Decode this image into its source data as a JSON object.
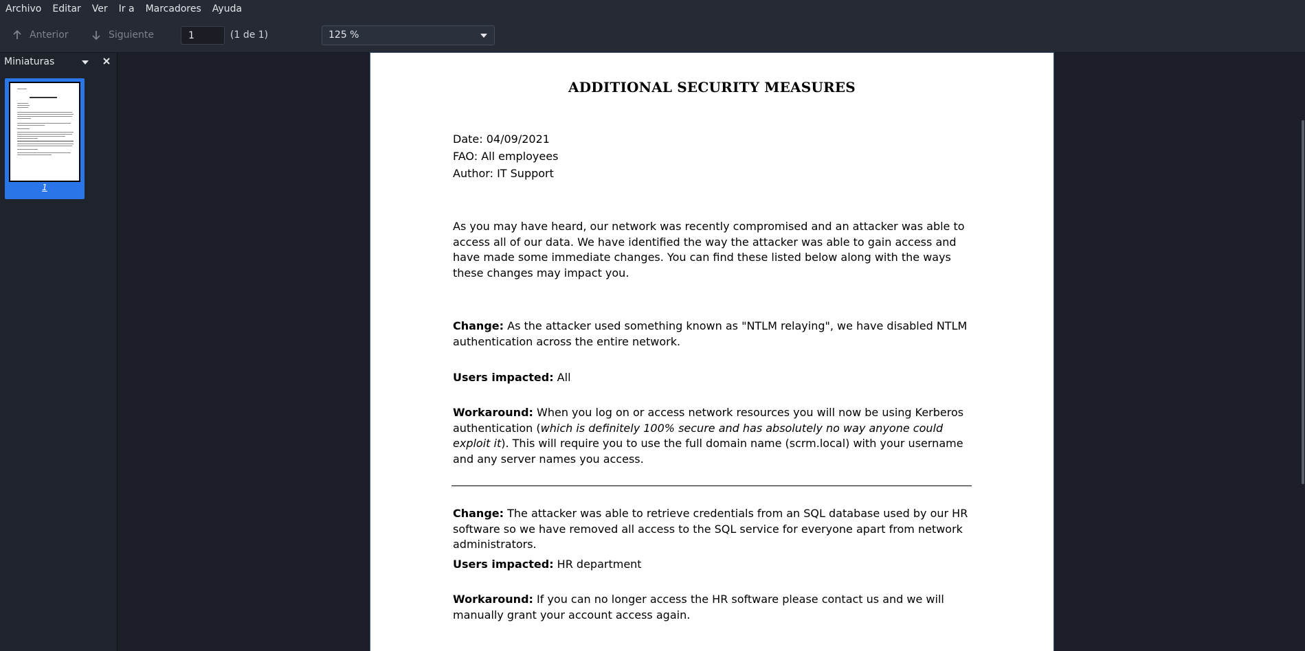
{
  "menu": [
    "Archivo",
    "Editar",
    "Ver",
    "Ir a",
    "Marcadores",
    "Ayuda"
  ],
  "toolbar": {
    "prev_label": "Anterior",
    "next_label": "Siguiente",
    "page_value": "1",
    "page_count": "(1 de 1)",
    "zoom": "125 %"
  },
  "sidebar": {
    "title": "Miniaturas",
    "thumbnail_page": "1"
  },
  "document": {
    "title": "ADDITIONAL SECURITY MEASURES",
    "date": "Date: 04/09/2021",
    "fao": "FAO: All employees",
    "author": "Author: IT Support",
    "intro": "As you may have heard, our network was recently compromised and an attacker was able to access all of our data. We have identified the way the attacker was able to gain access and have made some immediate changes. You can find these listed below along with the ways these changes may impact you.",
    "section1": {
      "change_label": "Change:",
      "change_text": " As the attacker used something known as \"NTLM relaying\", we have disabled NTLM authentication across the entire network.",
      "users_label": "Users impacted:",
      "users_text": " All",
      "workaround_label": "Workaround:",
      "workaround_text_1": " When you log on or access network resources you will now be using Kerberos authentication (",
      "workaround_italic": "which is definitely 100% secure and has absolutely no way anyone could exploit it",
      "workaround_text_2": "). This will require you to use the full domain name (scrm.local) with your username and any server names you access."
    },
    "section2": {
      "change_label": "Change:",
      "change_text": " The attacker was able to retrieve credentials from an SQL database used by our HR software so we have removed all access to the SQL service for everyone apart from network administrators.",
      "users_label": "Users impacted:",
      "users_text": " HR department",
      "workaround_label": "Workaround:",
      "workaround_text": " If you can no longer access the HR software please contact us and we will manually grant your account access again."
    }
  },
  "colors": {
    "accent": "#2a76e8",
    "background": "#1c1f27",
    "toolbar": "#252a34"
  }
}
